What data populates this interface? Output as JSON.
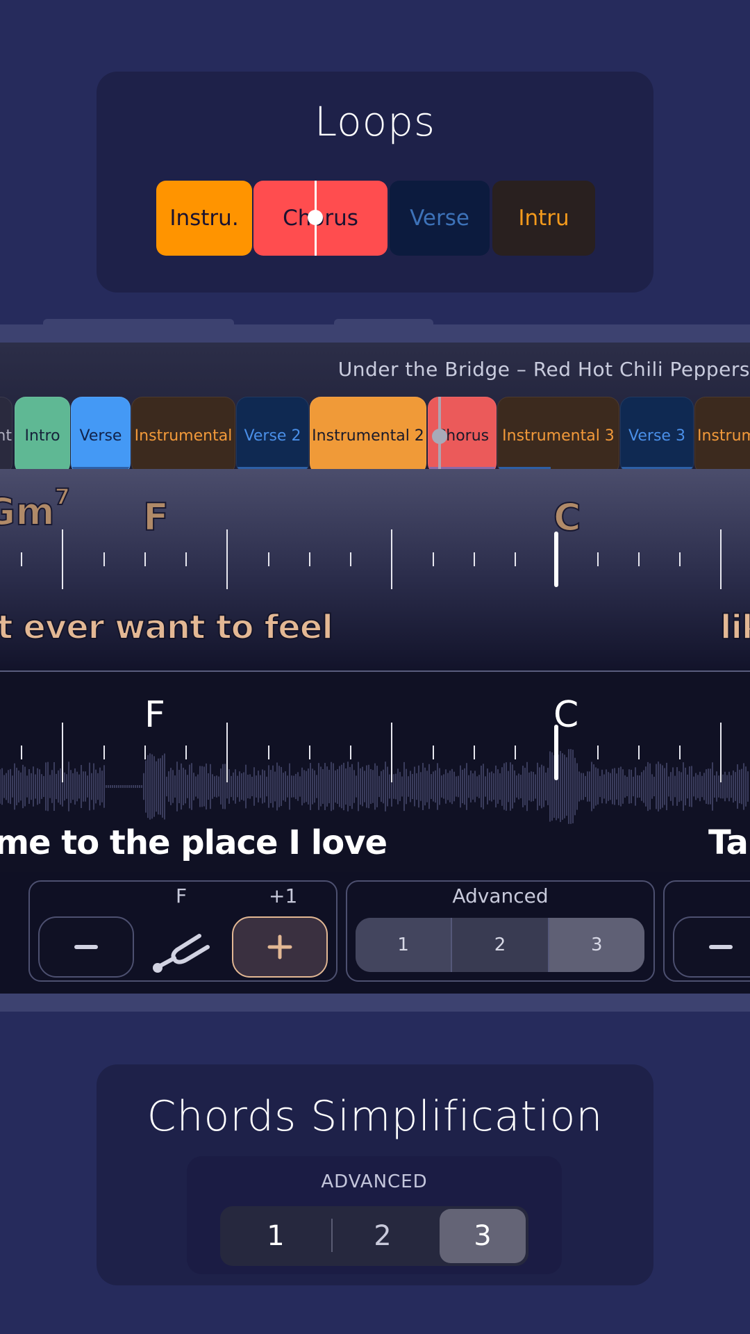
{
  "loops_card": {
    "title": "Loops",
    "segments": [
      {
        "label": "Instru.",
        "bg": "#ff9400",
        "color": "#1a1230"
      },
      {
        "label": "Chorus",
        "bg": "#ff4d4f",
        "color": "#1a1230",
        "active": true
      },
      {
        "label": "Verse",
        "bg": "#0c1b3e",
        "color": "#3d72b8"
      },
      {
        "label": "Intru",
        "bg": "#29201f",
        "color": "#f39a1c"
      }
    ]
  },
  "player": {
    "song_title": "Under the Bridge – Red Hot Chili Peppers",
    "sections": [
      {
        "label": "nt",
        "bg": "#2a2a3e",
        "color": "#b0b0c0"
      },
      {
        "label": "Intro",
        "bg": "#5fb894",
        "color": "#16223a"
      },
      {
        "label": "Verse",
        "bg": "#4499f5",
        "color": "#11224a"
      },
      {
        "label": "Instrumental",
        "bg": "#3c2a1e",
        "color": "#f39a3a"
      },
      {
        "label": "Verse 2",
        "bg": "#0f2952",
        "color": "#4a8fe8"
      },
      {
        "label": "Instrumental 2",
        "bg": "#f09a38",
        "color": "#1a1a2a"
      },
      {
        "label": "Chorus",
        "bg": "#eb5a5a",
        "color": "#1a1a2a",
        "active": true
      },
      {
        "label": "Instrumental 3",
        "bg": "#3c2a1e",
        "color": "#f39a3a"
      },
      {
        "label": "Verse 3",
        "bg": "#0f2952",
        "color": "#4a8fe8"
      },
      {
        "label": "Instrum",
        "bg": "#3c2a1e",
        "color": "#f39a3a"
      }
    ],
    "upcoming": {
      "chords": [
        {
          "name": "Gm",
          "ext": "7"
        },
        {
          "name": "F",
          "ext": ""
        },
        {
          "name": "C",
          "ext": ""
        }
      ],
      "lyrics_left": "'t ever want  to feel",
      "lyrics_right": "lik"
    },
    "current": {
      "chords": [
        {
          "name": "F"
        },
        {
          "name": "C"
        }
      ],
      "lyrics_left": "me to the  place I love",
      "lyrics_right": "Tal"
    },
    "controls": {
      "transpose": {
        "key_label": "F",
        "offset_label": "+1",
        "minus_label": "−",
        "plus_label": "+",
        "icon": "tuning-fork-icon"
      },
      "simplification": {
        "label": "Advanced",
        "options": [
          "1",
          "2",
          "3"
        ],
        "selected": "3"
      },
      "third_control": {
        "minus_label": "−"
      }
    }
  },
  "chords_card": {
    "title": "Chords Simplification",
    "level_label": "ADVANCED",
    "options": [
      "1",
      "2",
      "3"
    ],
    "selected": "3"
  }
}
